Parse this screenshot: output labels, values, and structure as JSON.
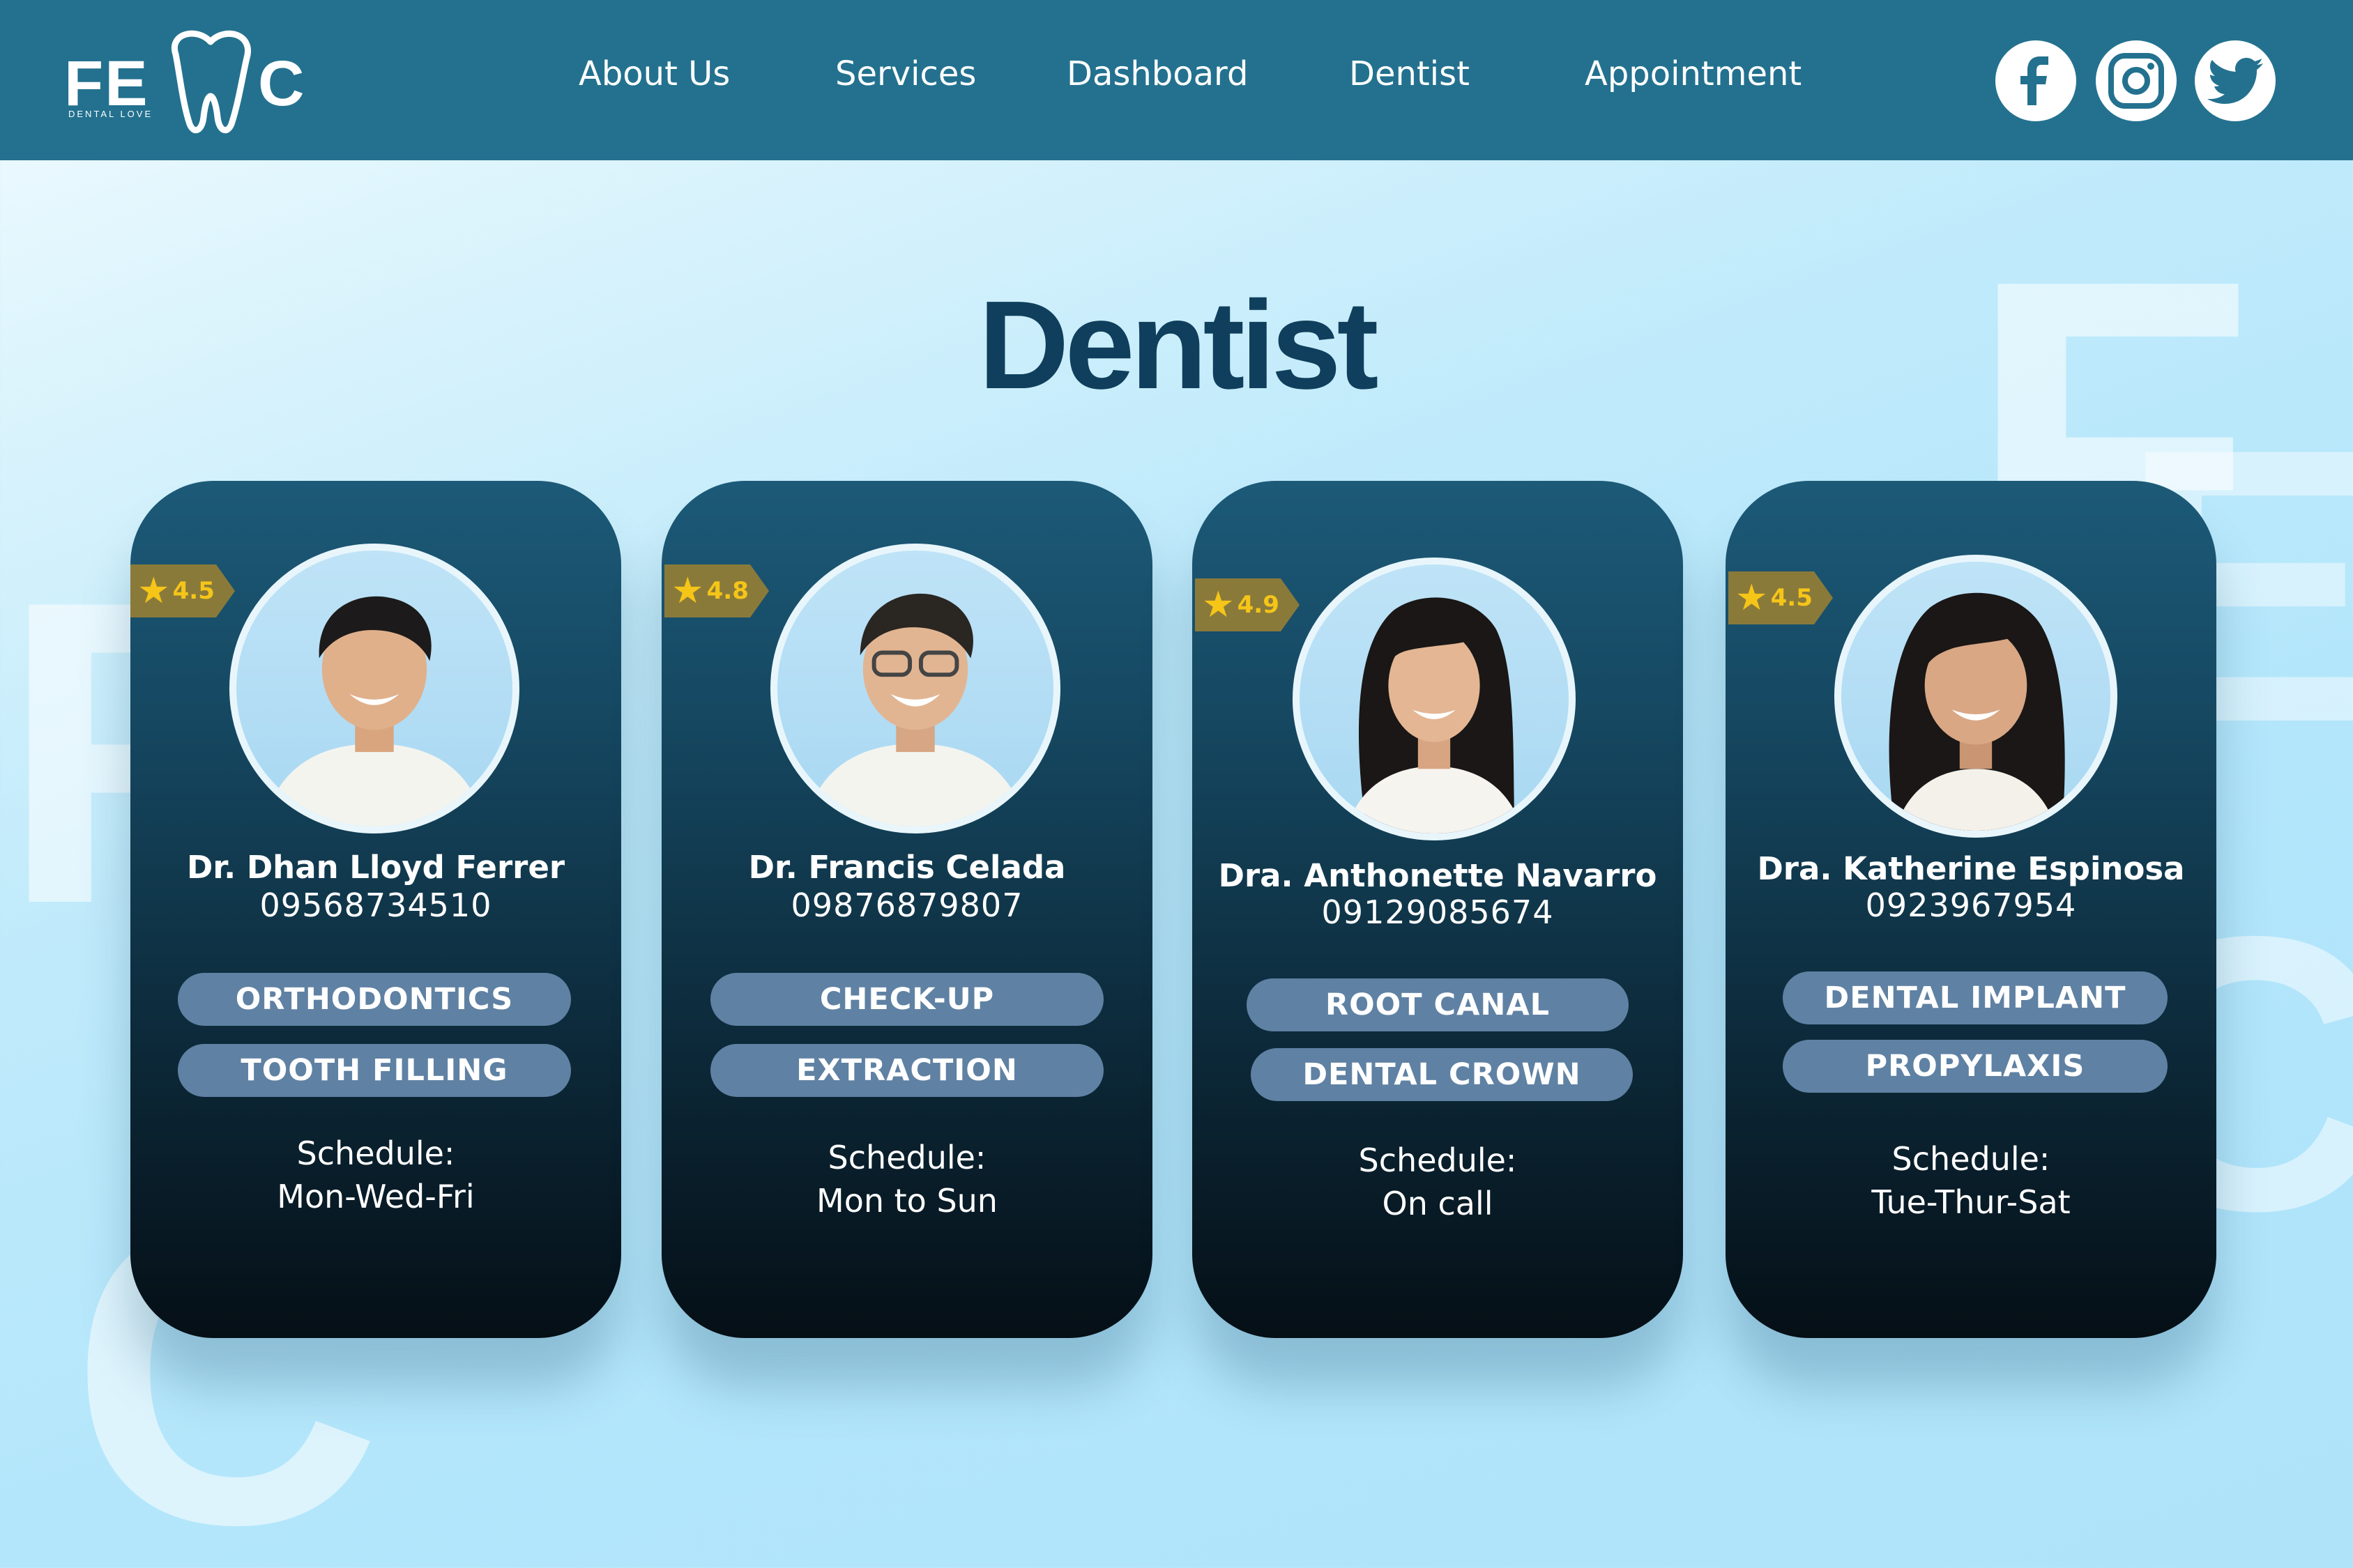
{
  "brand": {
    "logo_left": "FE",
    "logo_right": "C",
    "tagline": "DENTAL LOVE"
  },
  "nav": {
    "items": [
      "About Us",
      "Services",
      "Dashboard",
      "Dentist",
      "Appointment"
    ]
  },
  "social": {
    "icons": [
      "facebook-icon",
      "instagram-icon",
      "twitter-icon"
    ]
  },
  "page": {
    "title": "Dentist"
  },
  "colors": {
    "header": "#23718f",
    "title": "#0f3f5c",
    "pill": "#5f81a3",
    "rating_badge": "#8a7a3a",
    "star": "#f5c518"
  },
  "dentists": [
    {
      "rating": "4.5",
      "name": "Dr. Dhan Lloyd Ferrer",
      "phone": "09568734510",
      "services": [
        "ORTHODONTICS",
        "TOOTH FILLING"
      ],
      "schedule_label": "Schedule:",
      "schedule": "Mon-Wed-Fri"
    },
    {
      "rating": "4.8",
      "name": "Dr. Francis Celada",
      "phone": "09876879807",
      "services": [
        "CHECK-UP",
        "EXTRACTION"
      ],
      "schedule_label": "Schedule:",
      "schedule": "Mon to Sun"
    },
    {
      "rating": "4.9",
      "name": "Dra. Anthonette Navarro",
      "phone": "09129085674",
      "services": [
        "ROOT CANAL",
        "DENTAL CROWN"
      ],
      "schedule_label": "Schedule:",
      "schedule": "On call"
    },
    {
      "rating": "4.5",
      "name": "Dra. Katherine Espinosa",
      "phone": "0923967954",
      "services": [
        "DENTAL IMPLANT",
        "PROPYLAXIS"
      ],
      "schedule_label": "Schedule:",
      "schedule": "Tue-Thur-Sat"
    }
  ]
}
